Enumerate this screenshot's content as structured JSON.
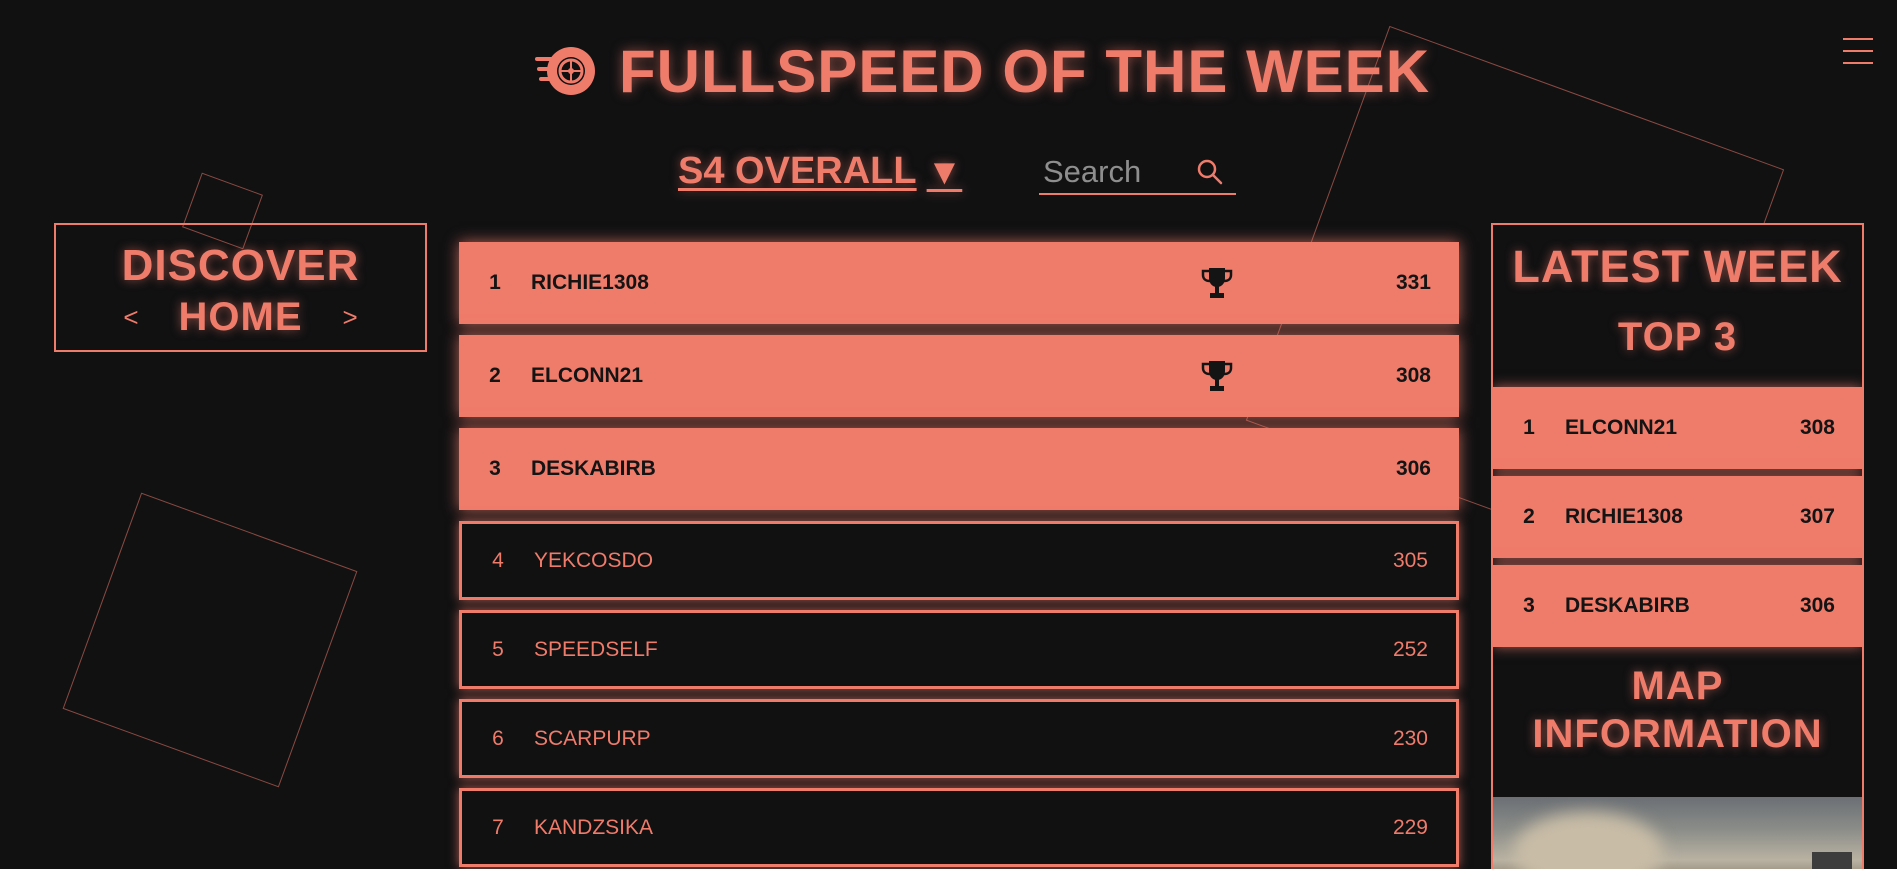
{
  "header": {
    "title": "FULLSPEED OF THE WEEK",
    "logo_icon": "speeding-wheel-icon",
    "menu_icon": "hamburger-menu-icon"
  },
  "filter": {
    "season_label": "S4 OVERALL",
    "caret": "▼",
    "search_placeholder": "Search",
    "search_icon": "search-icon"
  },
  "discover": {
    "heading": "DISCOVER",
    "prev": "<",
    "current": "HOME",
    "next": ">"
  },
  "leaderboard": [
    {
      "rank": "1",
      "name": "RICHIE1308",
      "score": "331",
      "trophy": true
    },
    {
      "rank": "2",
      "name": "ELCONN21",
      "score": "308",
      "trophy": true
    },
    {
      "rank": "3",
      "name": "DESKABIRB",
      "score": "306",
      "trophy": false
    },
    {
      "rank": "4",
      "name": "YEKCOSDO",
      "score": "305",
      "trophy": false
    },
    {
      "rank": "5",
      "name": "SPEEDSELF",
      "score": "252",
      "trophy": false
    },
    {
      "rank": "6",
      "name": "SCARPURP",
      "score": "230",
      "trophy": false
    },
    {
      "rank": "7",
      "name": "KANDZSIKA",
      "score": "229",
      "trophy": false
    }
  ],
  "latest_week": {
    "heading": "LATEST WEEK",
    "subheading": "TOP 3",
    "rows": [
      {
        "rank": "1",
        "name": "ELCONN21",
        "score": "308"
      },
      {
        "rank": "2",
        "name": "RICHIE1308",
        "score": "307"
      },
      {
        "rank": "3",
        "name": "DESKABIRB",
        "score": "306"
      }
    ],
    "map_heading": "MAP INFORMATION"
  },
  "colors": {
    "accent": "#ef7b6b",
    "background": "#111112",
    "text_dark": "#141414"
  }
}
